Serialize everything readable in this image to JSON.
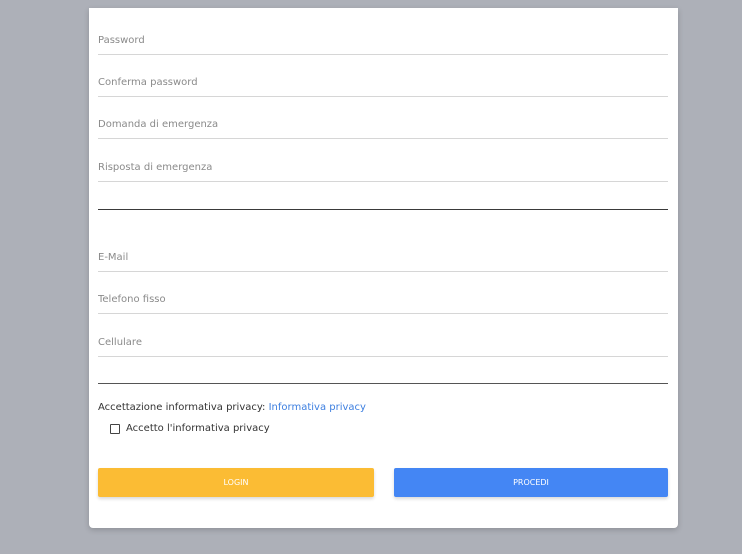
{
  "form": {
    "fields": [
      {
        "placeholder": "Password",
        "value": ""
      },
      {
        "placeholder": "Conferma password",
        "value": ""
      },
      {
        "placeholder": "Domanda di emergenza",
        "value": ""
      },
      {
        "placeholder": "Risposta di emergenza",
        "value": ""
      },
      {
        "placeholder": "E-Mail",
        "value": ""
      },
      {
        "placeholder": "Telefono fisso",
        "value": ""
      },
      {
        "placeholder": "Cellulare",
        "value": ""
      }
    ],
    "privacy_label": "Accettazione informativa privacy:",
    "privacy_link": "Informativa privacy",
    "accept_checkbox_label": "Accetto l'informativa privacy",
    "accept_checked": false,
    "login_label": "LOGIN",
    "procedi_label": "PROCEDI"
  },
  "colors": {
    "background": "#adb0b8",
    "login_button": "#fbbc34",
    "procedi_button": "#4486f4",
    "link": "#3d7fe0"
  }
}
